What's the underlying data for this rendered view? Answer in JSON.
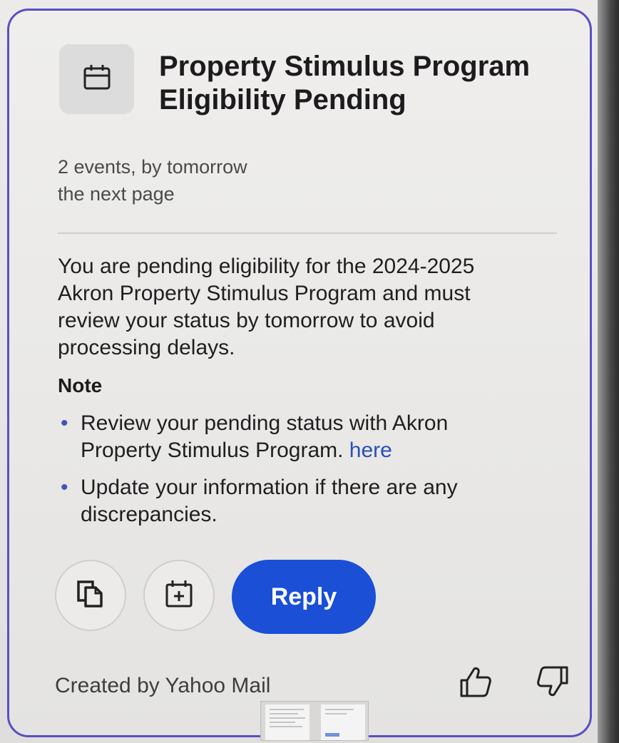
{
  "card": {
    "title_line1": "Property Stimulus Program",
    "title_line2": "Eligibility Pending",
    "meta_line1": "2 events, by tomorrow",
    "meta_line2": "the next page",
    "body_line1": "You are pending eligibility for the 2024-2025",
    "body_line2": "Akron Property Stimulus Program and must",
    "body_line3": "review your status by tomorrow to avoid",
    "body_line4": "processing delays.",
    "note_heading": "Note",
    "bullets": [
      {
        "line1": "Review your pending status with Akron",
        "line2": "Property Stimulus Program. ",
        "link": "here"
      },
      {
        "line1": "Update your information if there are any",
        "line2": "discrepancies."
      }
    ],
    "bullet_symbol": "•",
    "icon": "calendar-icon"
  },
  "actions": {
    "copy_icon": "copy-icon",
    "add_event_icon": "calendar-add-icon",
    "reply_label": "Reply"
  },
  "footer": {
    "created_by": "Created by Yahoo Mail",
    "thumbs_up_icon": "thumbs-up-icon",
    "thumbs_down_icon": "thumbs-down-icon"
  },
  "colors": {
    "card_border": "#5a4fc4",
    "reply_button": "#1a4fd6",
    "link": "#2a50b5"
  }
}
